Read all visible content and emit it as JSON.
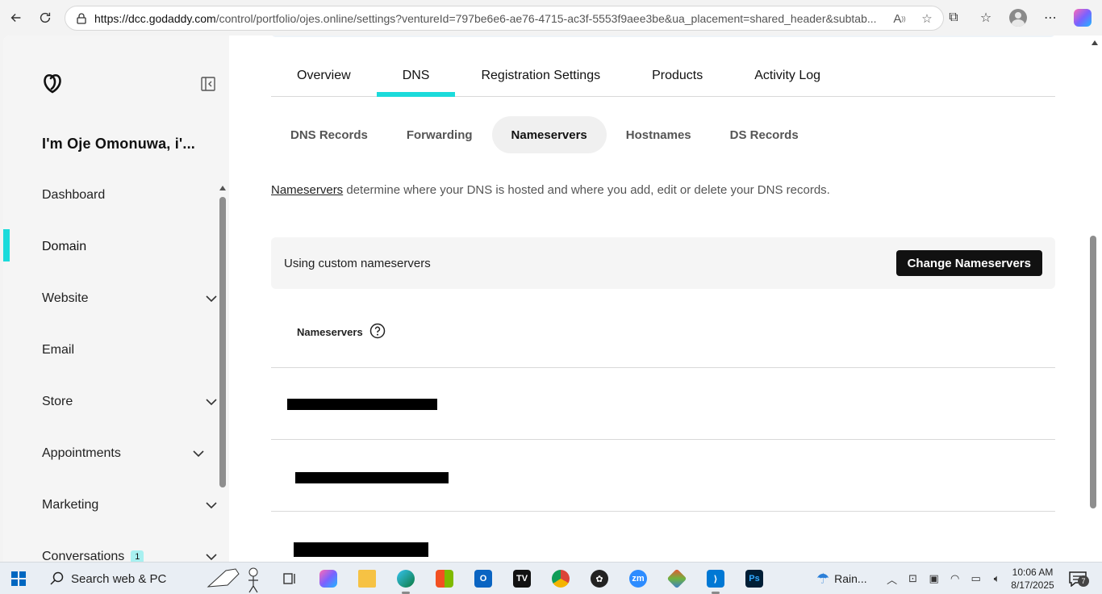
{
  "browser": {
    "url_host": "https://dcc.godaddy.com",
    "url_rest": "/control/portfolio/ojes.online/settings?ventureId=797be6e6-ae76-4715-ac3f-5553f9aee3be&ua_placement=shared_header&subtab..."
  },
  "sidebar": {
    "account_name": "I'm Oje Omonuwa, i'...",
    "items": [
      {
        "label": "Dashboard",
        "has_chevron": false
      },
      {
        "label": "Domain",
        "active": true,
        "has_chevron": false
      },
      {
        "label": "Website",
        "has_chevron": true
      },
      {
        "label": "Email",
        "has_chevron": false
      },
      {
        "label": "Store",
        "has_chevron": true
      },
      {
        "label": "Appointments",
        "has_chevron": true
      },
      {
        "label": "Marketing",
        "has_chevron": true
      },
      {
        "label": "Conversations",
        "has_chevron": true,
        "badge": "1"
      }
    ]
  },
  "tabs": [
    {
      "label": "Overview"
    },
    {
      "label": "DNS",
      "active": true
    },
    {
      "label": "Registration Settings"
    },
    {
      "label": "Products"
    },
    {
      "label": "Activity Log"
    }
  ],
  "subtabs": [
    {
      "label": "DNS Records"
    },
    {
      "label": "Forwarding"
    },
    {
      "label": "Nameservers",
      "active": true
    },
    {
      "label": "Hostnames"
    },
    {
      "label": "DS Records"
    }
  ],
  "description": {
    "link": "Nameservers",
    "text": " determine where your DNS is hosted and where you add, edit or delete your DNS records."
  },
  "banner": {
    "text": "Using custom nameservers",
    "button": "Change Nameservers"
  },
  "nameservers": {
    "header": "Nameservers"
  },
  "taskbar": {
    "search_text": "Search web & PC",
    "weather": "Rain...",
    "time": "10:06 AM",
    "date": "8/17/2025",
    "notification_count": "7"
  },
  "colors": {
    "accent": "#1bdbdb",
    "button_bg": "#111111"
  }
}
